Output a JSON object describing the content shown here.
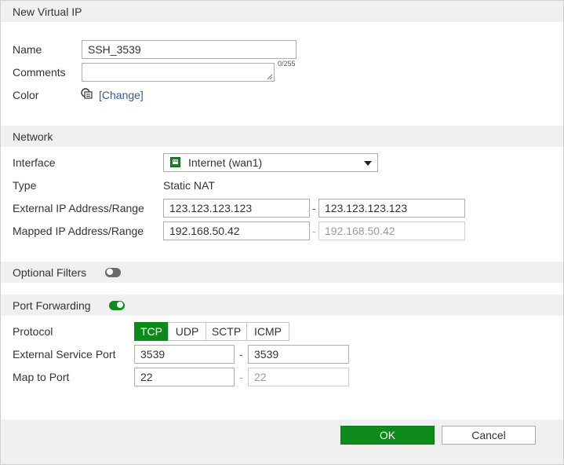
{
  "dialog": {
    "title": "New Virtual IP"
  },
  "general": {
    "name_label": "Name",
    "name_value": "SSH_3539",
    "comments_label": "Comments",
    "comments_value": "",
    "comments_counter": "0/255",
    "color_label": "Color",
    "color_change_link": "[Change]"
  },
  "network": {
    "header": "Network",
    "interface_label": "Interface",
    "interface_value": "Internet (wan1)",
    "type_label": "Type",
    "type_value": "Static NAT",
    "external_ip_label": "External IP Address/Range",
    "external_ip_start": "123.123.123.123",
    "external_ip_end": "123.123.123.123",
    "mapped_ip_label": "Mapped IP Address/Range",
    "mapped_ip_start": "192.168.50.42",
    "mapped_ip_end": "192.168.50.42",
    "range_separator": "-"
  },
  "optional_filters": {
    "label": "Optional Filters",
    "enabled": false
  },
  "port_forwarding": {
    "label": "Port Forwarding",
    "enabled": true,
    "protocol_label": "Protocol",
    "protocols": [
      "TCP",
      "UDP",
      "SCTP",
      "ICMP"
    ],
    "selected_protocol": "TCP",
    "external_port_label": "External Service Port",
    "external_port_start": "3539",
    "external_port_end": "3539",
    "map_port_label": "Map to Port",
    "map_port_start": "22",
    "map_port_end": "22"
  },
  "footer": {
    "ok_label": "OK",
    "cancel_label": "Cancel"
  },
  "colors": {
    "accent_green": "#0d8a1c",
    "link_blue": "#2f5d9e",
    "header_gray": "#f0f0f0",
    "toggle_off": "#6b6b6b"
  }
}
